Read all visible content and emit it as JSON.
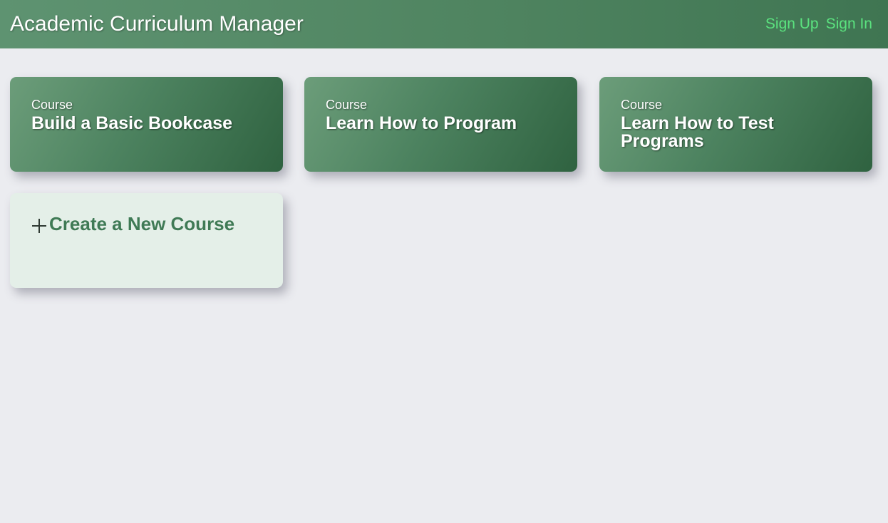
{
  "header": {
    "title": "Academic Curriculum Manager",
    "sign_up_label": "Sign Up",
    "sign_in_label": "Sign In"
  },
  "courses": [
    {
      "kicker": "Course",
      "title": "Build a Basic Bookcase"
    },
    {
      "kicker": "Course",
      "title": "Learn How to Program"
    },
    {
      "kicker": "Course",
      "title": "Learn How to Test Programs"
    }
  ],
  "create_card": {
    "label": "Create a New Course",
    "icon": "plus-icon"
  },
  "colors": {
    "header": "#5e9371",
    "card_accent": "#3f7552",
    "link": "#5be37f",
    "background": "#ebecf0",
    "create_card_bg": "#e4efe8"
  }
}
